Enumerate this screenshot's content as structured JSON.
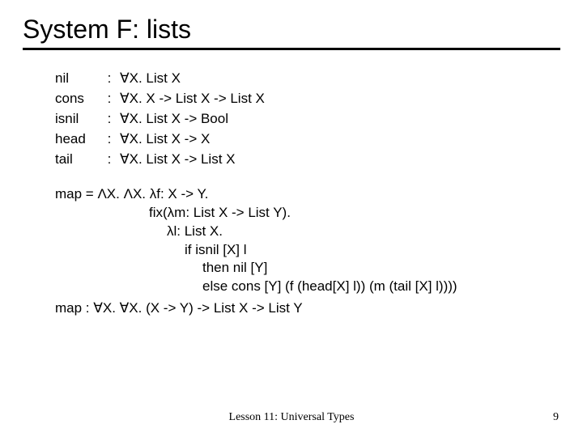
{
  "title": "System F: lists",
  "sigs": [
    {
      "name": "nil",
      "type": "∀X. List X"
    },
    {
      "name": "cons",
      "type": "∀X. X -> List X -> List X"
    },
    {
      "name": "isnil",
      "type": "∀X. List X -> Bool"
    },
    {
      "name": "head",
      "type": "∀X. List X -> X"
    },
    {
      "name": "tail",
      "type": "∀X. List X -> List X"
    }
  ],
  "mapdef": {
    "l0": "map  =  ΛX. ΛX. λf: X -> Y.",
    "l1": "fix(λm: List X -> List Y).",
    "l2": "λl: List X.",
    "l3": "if isnil [X] l",
    "l4": "then nil [Y]",
    "l5": "else cons [Y] (f (head[X] l)) (m (tail [X] l))))"
  },
  "mapsig": "map  :  ∀X. ∀X. (X -> Y) -> List X -> List Y",
  "footer": {
    "lesson": "Lesson 11: Universal Types",
    "page": "9"
  }
}
